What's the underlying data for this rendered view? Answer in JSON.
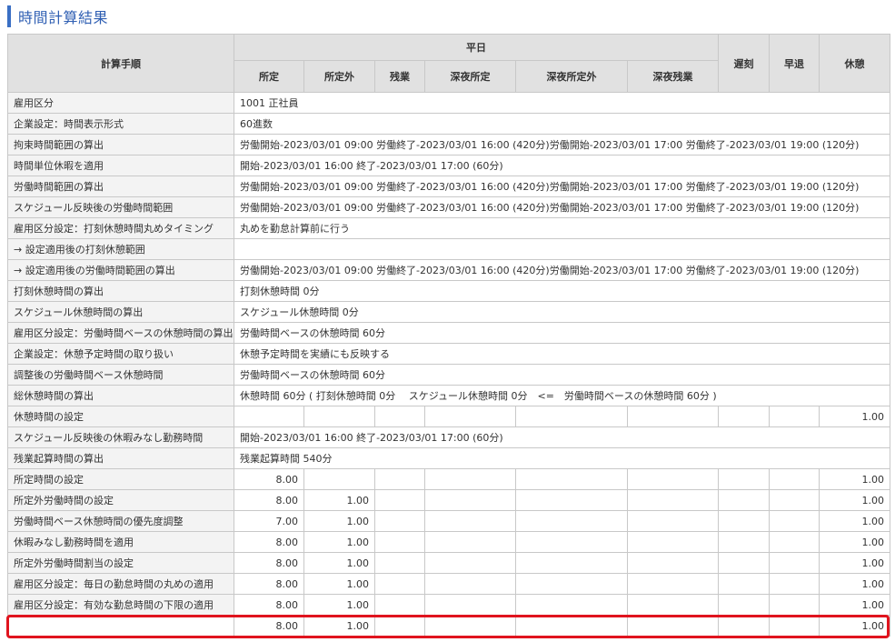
{
  "page": {
    "title": "時間計算結果"
  },
  "table": {
    "headers": {
      "step": "計算手順",
      "weekday_group": "平日",
      "late": "遅刻",
      "early_leave": "早退",
      "break": "休憩",
      "weekday_cols": [
        "所定",
        "所定外",
        "残業",
        "深夜所定",
        "深夜所定外",
        "深夜残業"
      ]
    },
    "detail_rows": [
      {
        "label": "雇用区分",
        "detail": "1001 正社員"
      },
      {
        "label": "企業設定：時間表示形式",
        "detail": "60進数"
      },
      {
        "label": "拘束時間範囲の算出",
        "detail": "労働開始-2023/03/01 09:00 労働終了-2023/03/01 16:00 (420分)労働開始-2023/03/01 17:00 労働終了-2023/03/01 19:00 (120分)"
      },
      {
        "label": "時間単位休暇を適用",
        "detail": "開始-2023/03/01 16:00 終了-2023/03/01 17:00 (60分)"
      },
      {
        "label": "労働時間範囲の算出",
        "detail": "労働開始-2023/03/01 09:00 労働終了-2023/03/01 16:00 (420分)労働開始-2023/03/01 17:00 労働終了-2023/03/01 19:00 (120分)"
      },
      {
        "label": "スケジュール反映後の労働時間範囲",
        "detail": "労働開始-2023/03/01 09:00 労働終了-2023/03/01 16:00 (420分)労働開始-2023/03/01 17:00 労働終了-2023/03/01 19:00 (120分)"
      },
      {
        "label": "雇用区分設定：打刻休憩時間丸めタイミング",
        "detail": "丸めを勤怠計算前に行う"
      },
      {
        "label": "→ 設定適用後の打刻休憩範囲",
        "detail": ""
      },
      {
        "label": "→ 設定適用後の労働時間範囲の算出",
        "detail": "労働開始-2023/03/01 09:00 労働終了-2023/03/01 16:00 (420分)労働開始-2023/03/01 17:00 労働終了-2023/03/01 19:00 (120分)"
      },
      {
        "label": "打刻休憩時間の算出",
        "detail": "打刻休憩時間 0分"
      },
      {
        "label": "スケジュール休憩時間の算出",
        "detail": "スケジュール休憩時間 0分"
      },
      {
        "label": "雇用区分設定：労働時間ベースの休憩時間の算出",
        "detail": "労働時間ベースの休憩時間 60分"
      },
      {
        "label": "企業設定：休憩予定時間の取り扱い",
        "detail": "休憩予定時間を実績にも反映する"
      },
      {
        "label": "調整後の労働時間ベース休憩時間",
        "detail": "労働時間ベースの休憩時間 60分"
      },
      {
        "label": "総休憩時間の算出",
        "detail": "休憩時間 60分 ( 打刻休憩時間 0分　 スケジュール休憩時間 0分　<=　労働時間ベースの休憩時間 60分 )"
      }
    ],
    "break_setting_row": {
      "label": "休憩時間の設定",
      "break": "1.00"
    },
    "detail_rows_2": [
      {
        "label": "スケジュール反映後の休暇みなし勤務時間",
        "detail": "開始-2023/03/01 16:00 終了-2023/03/01 17:00 (60分)"
      },
      {
        "label": "残業起算時間の算出",
        "detail": "残業起算時間 540分"
      }
    ],
    "numeric_rows": [
      {
        "label": "所定時間の設定",
        "scheduled": "8.00",
        "non_scheduled": "",
        "break": "1.00"
      },
      {
        "label": "所定外労働時間の設定",
        "scheduled": "8.00",
        "non_scheduled": "1.00",
        "break": "1.00"
      },
      {
        "label": "労働時間ベース休憩時間の優先度調整",
        "scheduled": "7.00",
        "non_scheduled": "1.00",
        "break": "1.00"
      },
      {
        "label": "休暇みなし勤務時間を適用",
        "scheduled": "8.00",
        "non_scheduled": "1.00",
        "break": "1.00"
      },
      {
        "label": "所定外労働時間割当の設定",
        "scheduled": "8.00",
        "non_scheduled": "1.00",
        "break": "1.00"
      },
      {
        "label": "雇用区分設定：毎日の勤怠時間の丸めの適用",
        "scheduled": "8.00",
        "non_scheduled": "1.00",
        "break": "1.00"
      },
      {
        "label": "雇用区分設定：有効な勤怠時間の下限の適用",
        "scheduled": "8.00",
        "non_scheduled": "1.00",
        "break": "1.00"
      }
    ],
    "total_row": {
      "label": "",
      "scheduled": "8.00",
      "non_scheduled": "1.00",
      "break": "1.00"
    }
  },
  "colors": {
    "accent": "#3a6fc4",
    "highlight": "#e0141e",
    "header_bg": "#e1e1e1"
  }
}
